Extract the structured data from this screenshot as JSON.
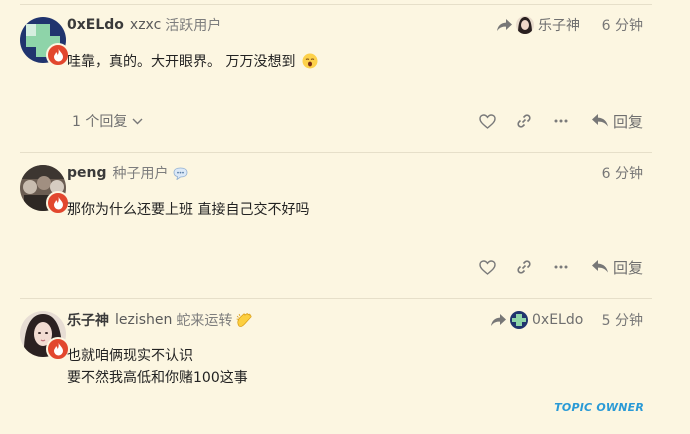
{
  "posts": [
    {
      "username": "0xELdo",
      "full_name": "xzxc",
      "user_title": "活跃用户",
      "reply_to": {
        "username": "乐子神"
      },
      "time": "6 分钟",
      "body": [
        "哇靠，真的。大开眼界。 万万没想到"
      ],
      "body_emoji": "yawning-face",
      "replies_label": "1 个回复",
      "reply_label": "回复"
    },
    {
      "username": "peng",
      "full_name": "",
      "user_title": "种子用户",
      "status_emoji": "speech-bubble",
      "time": "6 分钟",
      "body": [
        "那你为什么还要上班 直接自己交不好吗"
      ],
      "reply_label": "回复"
    },
    {
      "username": "乐子神",
      "full_name": "lezishen",
      "user_title": "蛇来运转",
      "status_emoji": "clapping-hands",
      "reply_to": {
        "username": "0xELdo"
      },
      "time": "5 分钟",
      "body": [
        "也就咱俩现实不认识",
        "要不然我高低和你赌100这事"
      ],
      "badge": "TOPIC OWNER"
    }
  ],
  "colors": {
    "background": "#fcf6e1",
    "divider": "#e6dfc9",
    "flair": "#e2472e",
    "topic_owner": "#2a9ad6",
    "muted_text": "#6f6f6f"
  }
}
